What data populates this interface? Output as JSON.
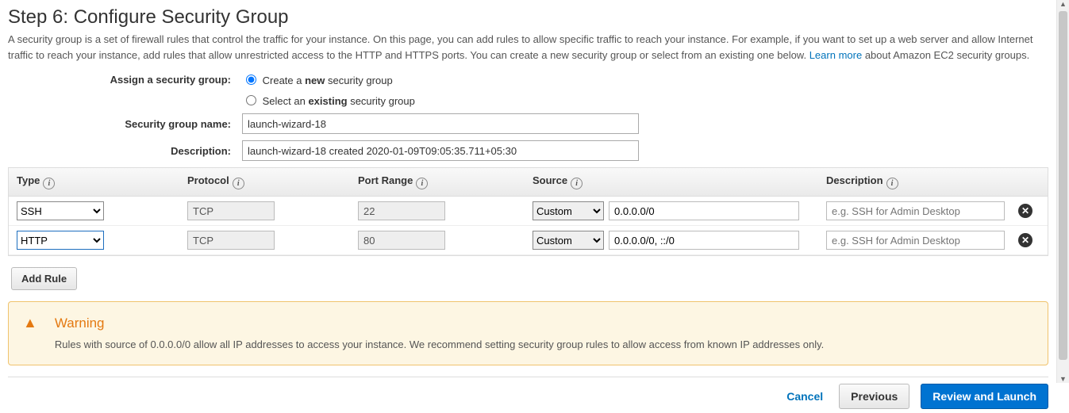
{
  "step_title": "Step 6: Configure Security Group",
  "intro_1": "A security group is a set of firewall rules that control the traffic for your instance. On this page, you can add rules to allow specific traffic to reach your instance. For example, if you want to set up a web server and allow Internet traffic to reach your instance, add rules that allow unrestricted access to the HTTP and HTTPS ports. You can create a new security group or select from an existing one below. ",
  "learn_more": "Learn more",
  "intro_2": " about Amazon EC2 security groups.",
  "labels": {
    "assign": "Assign a security group:",
    "create_pre": "Create a ",
    "create_bold": "new",
    "create_post": " security group",
    "select_pre": "Select an ",
    "select_bold": "existing",
    "select_post": " security group",
    "sg_name": "Security group name:",
    "sg_desc": "Description:"
  },
  "sg_name_value": "launch-wizard-18",
  "sg_desc_value": "launch-wizard-18 created 2020-01-09T09:05:35.711+05:30",
  "columns": {
    "type": "Type",
    "protocol": "Protocol",
    "port": "Port Range",
    "source": "Source",
    "description": "Description"
  },
  "rows": [
    {
      "type": "SSH",
      "protocol": "TCP",
      "port": "22",
      "source_mode": "Custom",
      "cidr": "0.0.0.0/0",
      "desc_ph": "e.g. SSH for Admin Desktop",
      "active": false
    },
    {
      "type": "HTTP",
      "protocol": "TCP",
      "port": "80",
      "source_mode": "Custom",
      "cidr": "0.0.0.0/0, ::/0",
      "desc_ph": "e.g. SSH for Admin Desktop",
      "active": true
    }
  ],
  "add_rule_label": "Add Rule",
  "warning": {
    "title": "Warning",
    "body": "Rules with source of 0.0.0.0/0 allow all IP addresses to access your instance. We recommend setting security group rules to allow access from known IP addresses only."
  },
  "footer": {
    "cancel": "Cancel",
    "previous": "Previous",
    "review": "Review and Launch"
  }
}
